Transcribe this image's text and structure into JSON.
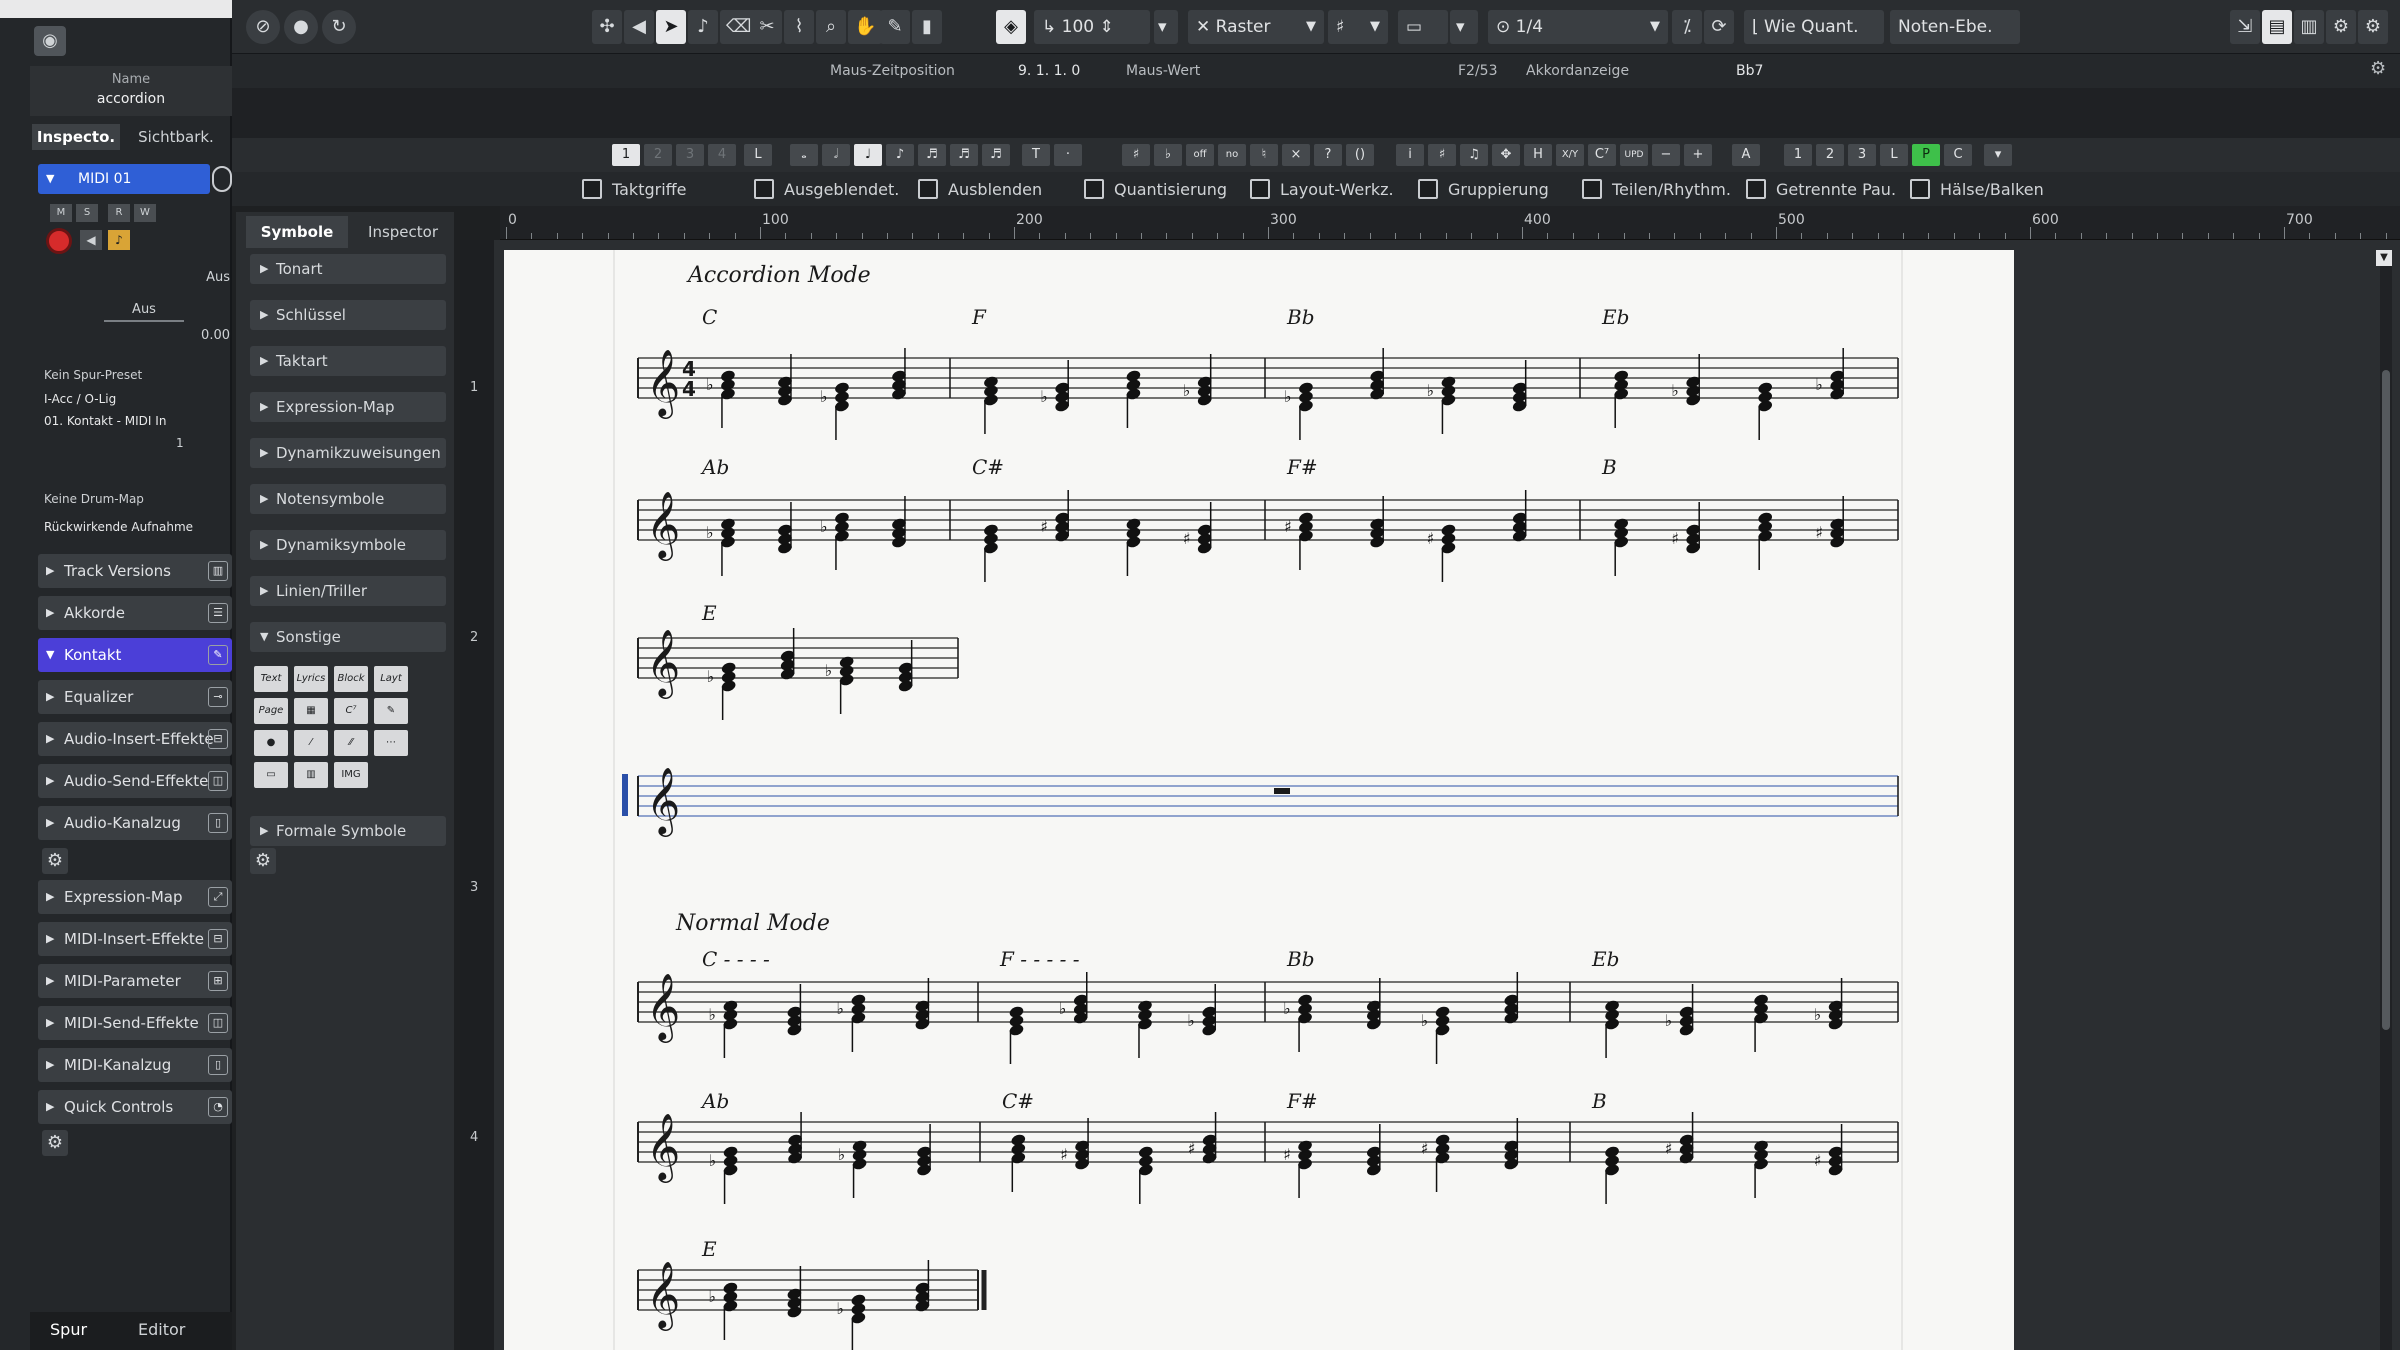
{
  "inspector": {
    "name_label": "Name",
    "name_value": "accordion",
    "tab_inspector": "Inspecto.",
    "tab_visibility": "Sichtbark.",
    "track_name": "MIDI 01",
    "aus": "Aus",
    "value_00": "0.00",
    "preset": "Kein Spur-Preset",
    "input": "I-Acc / O-Lig",
    "output": "01. Kontakt - MIDI In",
    "channel": "1",
    "drum_map": "Keine Drum-Map",
    "rec_mode": "Rückwirkende Aufnahme",
    "sections": [
      "Track Versions",
      "Akkorde",
      "Kontakt",
      "Equalizer",
      "Audio-Insert-Effekte",
      "Audio-Send-Effekte",
      "Audio-Kanalzug",
      "Expression-Map",
      "MIDI-Insert-Effekte",
      "MIDI-Parameter",
      "MIDI-Send-Effekte",
      "MIDI-Kanalzug",
      "Quick Controls"
    ],
    "bottom_tabs": [
      "Spur",
      "Editor"
    ]
  },
  "toolbar": {
    "velocity": "100",
    "snap": "Raster",
    "quantize": "1/4",
    "length_quant": "Wie Quant.",
    "note_level": "Noten-Ebe."
  },
  "infobar": {
    "mouse_pos_label": "Maus-Zeitposition",
    "mouse_pos_value": "9. 1. 1.   0",
    "mouse_value_label": "Maus-Wert",
    "pitch": "F2/53",
    "chord_label": "Akkordanzeige",
    "chord_value": "Bb7"
  },
  "notebar": {
    "voices": [
      "1",
      "2",
      "3",
      "4"
    ],
    "L": "L",
    "right_voices": [
      "1",
      "2",
      "3",
      "L",
      "P",
      "C"
    ],
    "A": "A"
  },
  "filters": [
    "Taktgriffe",
    "Ausgeblendet.",
    "Ausblenden",
    "Quantisierung",
    "Layout-Werkz.",
    "Gruppierung",
    "Teilen/Rhythm.",
    "Getrennte Pau.",
    "Hälse/Balken"
  ],
  "symbols": {
    "tab_symbols": "Symbole",
    "tab_inspector": "Inspector",
    "sections": [
      "Tonart",
      "Schlüssel",
      "Taktart",
      "Expression-Map",
      "Dynamikzuweisungen",
      "Notensymbole",
      "Dynamiksymbole",
      "Linien/Triller",
      "Sonstige",
      "Formale Symbole"
    ],
    "other_buttons": [
      "Text",
      "Lyrics",
      "Block Text",
      "Layt Text",
      "Page Text",
      "▦",
      "C⁷",
      "✎"
    ]
  },
  "ruler_marks": [
    "0",
    "100",
    "200",
    "300",
    "400",
    "500",
    "600",
    "700"
  ],
  "score": {
    "section1": "Accordion Mode",
    "section2": "Normal Mode",
    "chords_row1": [
      "C",
      "F",
      "Bb",
      "Eb"
    ],
    "chords_row2": [
      "Ab",
      "C#",
      "F#",
      "B"
    ],
    "chords_row3": [
      "E"
    ],
    "chords_row5": [
      "C - - - -",
      "F - - - - -",
      "Bb",
      "Eb"
    ],
    "chords_row6": [
      "Ab",
      "C#",
      "F#",
      "B"
    ],
    "chords_row7": [
      "E"
    ]
  }
}
